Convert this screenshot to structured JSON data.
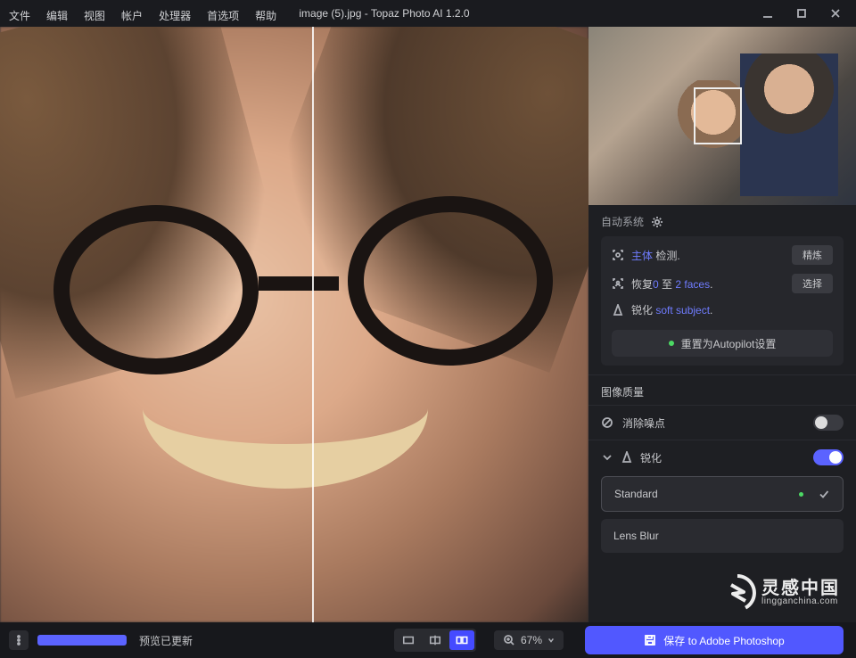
{
  "window": {
    "title": "image (5).jpg - Topaz Photo AI 1.2.0"
  },
  "menu": {
    "items": [
      "文件",
      "编辑",
      "视图",
      "帐户",
      "处理器",
      "首选项",
      "帮助"
    ]
  },
  "autopilot": {
    "heading": "自动系统",
    "subject_prefix": "主体",
    "subject_suffix": " 检测.",
    "refine_btn": "精炼",
    "recover_prefix": "恢复",
    "recover_count_a": "0",
    "recover_mid": " 至 ",
    "recover_count_b": "2",
    "recover_link": " faces",
    "recover_suffix": ".",
    "select_btn": "选择",
    "sharpen_prefix": "锐化 ",
    "sharpen_soft": "soft",
    "sharpen_subject": " subject",
    "sharpen_suffix": ".",
    "reset_btn": "重置为Autopilot设置"
  },
  "quality": {
    "heading": "图像质量",
    "denoise_label": "消除噪点",
    "denoise_on": false,
    "sharpen_label": "锐化",
    "sharpen_on": true,
    "options": [
      {
        "label": "Standard",
        "selected": true
      },
      {
        "label": "Lens Blur",
        "selected": false
      }
    ]
  },
  "bottom": {
    "status": "预览已更新",
    "zoom": "67%",
    "save": {
      "prefix": "保存",
      "suffix": " to Adobe Photoshop"
    }
  },
  "watermark": {
    "cn": "灵感中国",
    "en": "lingganchina.com"
  }
}
